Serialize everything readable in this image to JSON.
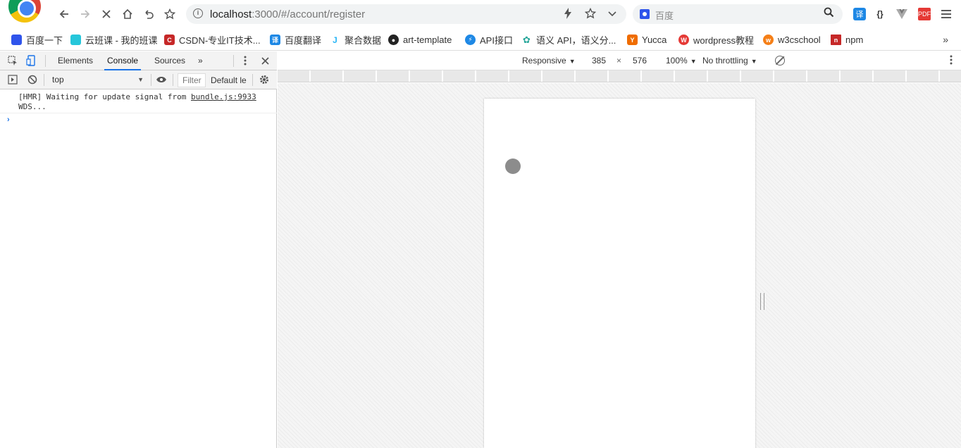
{
  "browser": {
    "url_host": "localhost",
    "url_path": ":3000/#/account/register",
    "search_placeholder": "百度",
    "extensions": {
      "translate": "译",
      "json_viewer": "{}",
      "pdf": "PDF"
    }
  },
  "bookmarks": [
    {
      "label": "百度一下",
      "icon": "paw-icon",
      "color": "#2f54eb",
      "glyph": ""
    },
    {
      "label": "云班课 - 我的班课",
      "icon": "cloud-class-icon",
      "color": "#26c6da",
      "glyph": ""
    },
    {
      "label": "CSDN-专业IT技术...",
      "icon": "csdn-icon",
      "color": "#c62828",
      "glyph": "C"
    },
    {
      "label": "百度翻译",
      "icon": "baidu-translate-icon",
      "color": "#1e88e5",
      "glyph": "译"
    },
    {
      "label": "聚合数据",
      "icon": "juhe-icon",
      "color": "#29b6f6",
      "glyph": "J"
    },
    {
      "label": "art-template",
      "icon": "github-icon",
      "color": "#222222",
      "glyph": "●"
    },
    {
      "label": "API接口",
      "icon": "api-icon",
      "color": "#1e88e5",
      "glyph": "⚡"
    },
    {
      "label": "语义 API，语义分...",
      "icon": "semantic-api-icon",
      "color": "#26a69a",
      "glyph": "✿"
    },
    {
      "label": "Yucca",
      "icon": "yucca-icon",
      "color": "#ef6c00",
      "glyph": "Y"
    },
    {
      "label": "wordpress教程",
      "icon": "wordpress-icon",
      "color": "#e53935",
      "glyph": "W"
    },
    {
      "label": "w3cschool",
      "icon": "w3cschool-icon",
      "color": "#f57f17",
      "glyph": "w"
    },
    {
      "label": "npm",
      "icon": "npm-icon",
      "color": "#c62828",
      "glyph": "n"
    }
  ],
  "bookmarks_more": "»",
  "devtools": {
    "tabs": [
      "Elements",
      "Console",
      "Sources"
    ],
    "active_tab": "Console",
    "more_tabs": "»",
    "context": "top",
    "filter_placeholder": "Filter",
    "levels": "Default le",
    "console_message": "[HMR] Waiting for update signal from",
    "console_message_line2": "WDS...",
    "console_source": "bundle.js:9933",
    "prompt": "›"
  },
  "device_toolbar": {
    "device": "Responsive",
    "width": "385",
    "times": "×",
    "height": "576",
    "zoom": "100%",
    "throttling": "No throttling"
  }
}
